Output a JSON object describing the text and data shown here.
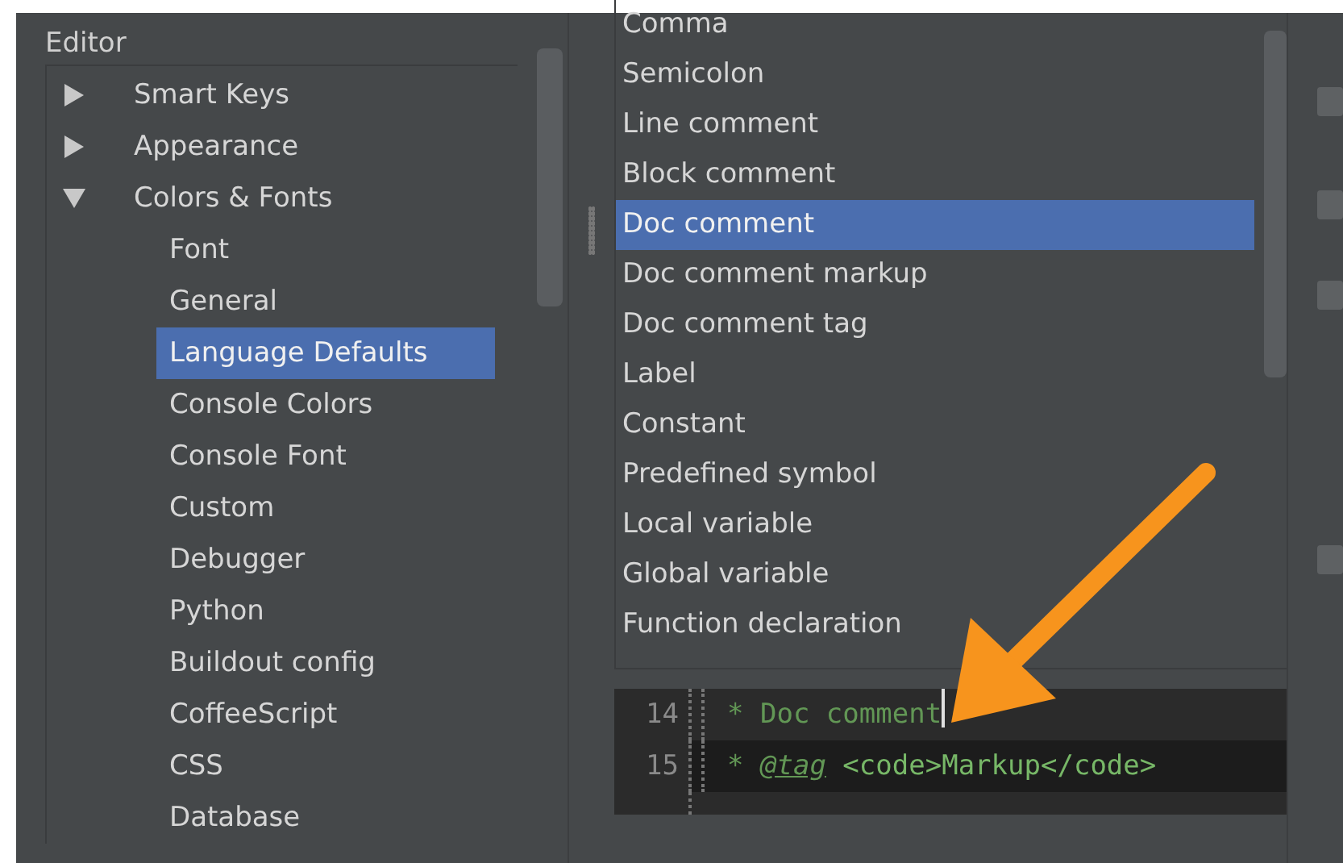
{
  "settings_tree": {
    "header": "Editor",
    "items": [
      {
        "label": "Smart Keys",
        "expanded": false,
        "selected": false
      },
      {
        "label": "Appearance",
        "expanded": false,
        "selected": false
      },
      {
        "label": "Colors & Fonts",
        "expanded": true,
        "selected": false,
        "children": [
          {
            "label": "Font",
            "selected": false
          },
          {
            "label": "General",
            "selected": false
          },
          {
            "label": "Language Defaults",
            "selected": true
          },
          {
            "label": "Console Colors",
            "selected": false
          },
          {
            "label": "Console Font",
            "selected": false
          },
          {
            "label": "Custom",
            "selected": false
          },
          {
            "label": "Debugger",
            "selected": false
          },
          {
            "label": "Python",
            "selected": false
          },
          {
            "label": "Buildout config",
            "selected": false
          },
          {
            "label": "CoffeeScript",
            "selected": false
          },
          {
            "label": "CSS",
            "selected": false
          },
          {
            "label": "Database",
            "selected": false
          }
        ]
      }
    ]
  },
  "attributes_list": {
    "items": [
      {
        "label": "Comma",
        "selected": false
      },
      {
        "label": "Semicolon",
        "selected": false
      },
      {
        "label": "Line comment",
        "selected": false
      },
      {
        "label": "Block comment",
        "selected": false
      },
      {
        "label": "Doc comment",
        "selected": true
      },
      {
        "label": "Doc comment markup",
        "selected": false
      },
      {
        "label": "Doc comment tag",
        "selected": false
      },
      {
        "label": "Label",
        "selected": false
      },
      {
        "label": "Constant",
        "selected": false
      },
      {
        "label": "Predefined symbol",
        "selected": false
      },
      {
        "label": "Local variable",
        "selected": false
      },
      {
        "label": "Global variable",
        "selected": false
      },
      {
        "label": "Function declaration",
        "selected": false
      }
    ]
  },
  "option_checkboxes": [
    {
      "checked": false
    },
    {
      "checked": false
    },
    {
      "checked": false
    },
    {
      "checked": false
    }
  ],
  "preview": {
    "lines": [
      {
        "number": "14",
        "current": false,
        "caret": true,
        "tokens": [
          {
            "kind": "comment",
            "text": "* Doc comment"
          }
        ]
      },
      {
        "number": "15",
        "current": true,
        "caret": false,
        "tokens": [
          {
            "kind": "comment",
            "text": "* "
          },
          {
            "kind": "tag",
            "text": "@tag"
          },
          {
            "kind": "markup",
            "text": " <code>Markup</code>"
          }
        ]
      }
    ]
  }
}
